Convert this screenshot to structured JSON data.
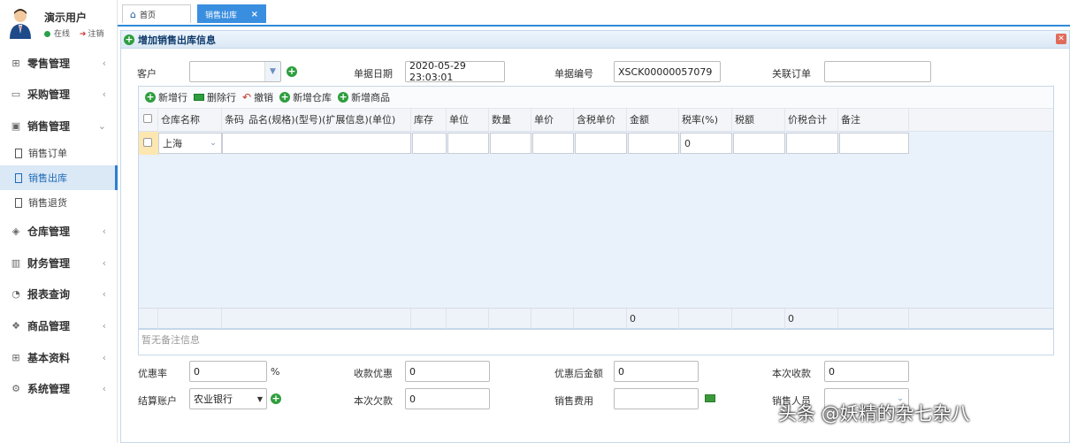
{
  "user": {
    "name": "演示用户",
    "status": "在线",
    "logout": "注销"
  },
  "sidebar": {
    "items": [
      {
        "label": "零售管理",
        "icon": "gift-icon"
      },
      {
        "label": "采购管理",
        "icon": "monitor-icon"
      },
      {
        "label": "销售管理",
        "icon": "briefcase-icon"
      },
      {
        "label": "仓库管理",
        "icon": "layers-icon"
      },
      {
        "label": "财务管理",
        "icon": "book-icon"
      },
      {
        "label": "报表查询",
        "icon": "pie-chart-icon"
      },
      {
        "label": "商品管理",
        "icon": "cubes-icon"
      },
      {
        "label": "基本资料",
        "icon": "grid-icon"
      },
      {
        "label": "系统管理",
        "icon": "gear-icon"
      }
    ],
    "sales_subitems": [
      {
        "label": "销售订单"
      },
      {
        "label": "销售出库",
        "active": true
      },
      {
        "label": "销售退货"
      }
    ]
  },
  "tabs": [
    {
      "label": "首页"
    },
    {
      "label": "销售出库",
      "active": true,
      "close": "×"
    }
  ],
  "panel": {
    "title": "增加销售出库信息"
  },
  "form": {
    "customer_label": "客户",
    "customer_value": "",
    "date_label": "单据日期",
    "date_value": "2020-05-29 23:03:01",
    "number_label": "单据编号",
    "number_value": "XSCK00000057079",
    "order_label": "关联订单",
    "order_value": ""
  },
  "toolbar": {
    "add_row": "新增行",
    "delete_row": "删除行",
    "undo": "撤销",
    "add_warehouse": "新增仓库",
    "add_product": "新增商品"
  },
  "grid": {
    "columns": [
      "仓库名称",
      "条码",
      "品名(规格)(型号)(扩展信息)(单位)",
      "库存",
      "单位",
      "数量",
      "单价",
      "含税单价",
      "金额",
      "税率(%)",
      "税额",
      "价税合计",
      "备注"
    ],
    "row": {
      "warehouse": "上海",
      "tax_rate": "0"
    },
    "footer": {
      "amount_total": "0",
      "total_with_tax": "0"
    }
  },
  "remark": {
    "placeholder": "暂无备注信息"
  },
  "bottom": {
    "discount_rate_label": "优惠率",
    "discount_rate_value": "0",
    "percent": "%",
    "collect_discount_label": "收款优惠",
    "collect_discount_value": "0",
    "after_discount_label": "优惠后金额",
    "after_discount_value": "0",
    "this_collect_label": "本次收款",
    "this_collect_value": "0",
    "account_label": "结算账户",
    "account_value": "农业银行",
    "debt_label": "本次欠款",
    "debt_value": "0",
    "sales_fee_label": "销售费用",
    "sales_fee_value": "",
    "salesman_label": "销售人员",
    "salesman_value": ""
  },
  "watermark": "头条 @妖精的杂七杂八",
  "colors": {
    "accent": "#2f8ad8",
    "active_tab": "#3a8ee0",
    "plus_green": "#2e9e3e"
  }
}
